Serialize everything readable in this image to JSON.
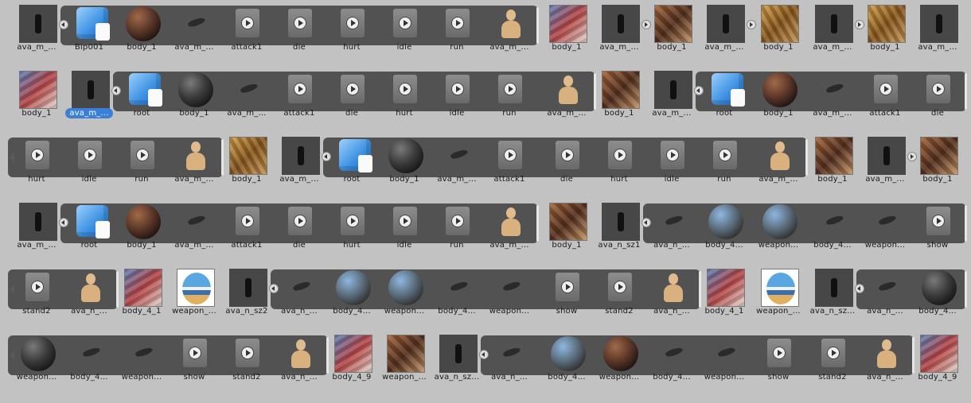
{
  "rows": [
    {
      "lead_arrow": false,
      "items": [
        {
          "label": "ava_m_...",
          "icon": "thumb-creature-icon",
          "kind": "thumb",
          "selected": false,
          "expand": "collapse"
        },
        {
          "label": "Bip001",
          "icon": "prefab-cube-icon",
          "kind": "cube"
        },
        {
          "label": "body_1",
          "icon": "material-sphere-icon",
          "kind": "sphere"
        },
        {
          "label": "ava_m_...",
          "icon": "mesh-icon",
          "kind": "mesh"
        },
        {
          "label": "attack1",
          "icon": "animation-clip-icon",
          "kind": "anim"
        },
        {
          "label": "die",
          "icon": "animation-clip-icon",
          "kind": "anim"
        },
        {
          "label": "hurt",
          "icon": "animation-clip-icon",
          "kind": "anim"
        },
        {
          "label": "idle",
          "icon": "animation-clip-icon",
          "kind": "anim"
        },
        {
          "label": "run",
          "icon": "animation-clip-icon",
          "kind": "anim"
        },
        {
          "label": "ava_m_...",
          "icon": "avatar-mannequin-icon",
          "kind": "mannequin"
        },
        {
          "label": "body_1",
          "icon": "texture-icon",
          "kind": "tile",
          "variant": "blue"
        },
        {
          "label": "ava_m_...",
          "icon": "thumb-creature-icon",
          "kind": "thumb",
          "expand": "expand"
        },
        {
          "label": "body_1",
          "icon": "texture-icon",
          "kind": "tile"
        },
        {
          "label": "ava_m_...",
          "icon": "thumb-creature-icon",
          "kind": "thumb",
          "expand": "expand"
        },
        {
          "label": "body_1",
          "icon": "texture-icon",
          "kind": "tile",
          "variant": "gold"
        },
        {
          "label": "ava_m_...",
          "icon": "thumb-creature-icon",
          "kind": "thumb",
          "expand": "expand"
        },
        {
          "label": "body_1",
          "icon": "texture-icon",
          "kind": "tile",
          "variant": "gold"
        },
        {
          "label": "ava_m_...",
          "icon": "thumb-creature-icon",
          "kind": "thumb"
        }
      ]
    },
    {
      "lead_arrow": false,
      "items": [
        {
          "label": "body_1",
          "icon": "texture-icon",
          "kind": "tile",
          "variant": "blue"
        },
        {
          "label": "ava_m_...",
          "icon": "thumb-creature-icon",
          "kind": "thumb",
          "selected": true,
          "expand": "collapse"
        },
        {
          "label": "root",
          "icon": "prefab-cube-icon",
          "kind": "cube"
        },
        {
          "label": "body_1",
          "icon": "material-sphere-icon",
          "kind": "sphere",
          "variant": "dark"
        },
        {
          "label": "ava_m_...",
          "icon": "mesh-icon",
          "kind": "mesh"
        },
        {
          "label": "attack1",
          "icon": "animation-clip-icon",
          "kind": "anim"
        },
        {
          "label": "die",
          "icon": "animation-clip-icon",
          "kind": "anim"
        },
        {
          "label": "hurt",
          "icon": "animation-clip-icon",
          "kind": "anim"
        },
        {
          "label": "idle",
          "icon": "animation-clip-icon",
          "kind": "anim"
        },
        {
          "label": "run",
          "icon": "animation-clip-icon",
          "kind": "anim"
        },
        {
          "label": "ava_m_...",
          "icon": "avatar-mannequin-icon",
          "kind": "mannequin"
        },
        {
          "label": "body_1",
          "icon": "texture-icon",
          "kind": "tile"
        },
        {
          "label": "ava_m_...",
          "icon": "thumb-creature-icon",
          "kind": "thumb",
          "expand": "collapse"
        },
        {
          "label": "root",
          "icon": "prefab-cube-icon",
          "kind": "cube"
        },
        {
          "label": "body_1",
          "icon": "material-sphere-icon",
          "kind": "sphere"
        },
        {
          "label": "ava_m_...",
          "icon": "mesh-icon",
          "kind": "mesh"
        },
        {
          "label": "attack1",
          "icon": "animation-clip-icon",
          "kind": "anim"
        },
        {
          "label": "die",
          "icon": "animation-clip-icon",
          "kind": "anim"
        }
      ]
    },
    {
      "lead_arrow": true,
      "items": [
        {
          "label": "hurt",
          "icon": "animation-clip-icon",
          "kind": "anim"
        },
        {
          "label": "idle",
          "icon": "animation-clip-icon",
          "kind": "anim"
        },
        {
          "label": "run",
          "icon": "animation-clip-icon",
          "kind": "anim"
        },
        {
          "label": "ava_m_...",
          "icon": "avatar-mannequin-icon",
          "kind": "mannequin"
        },
        {
          "label": "body_1",
          "icon": "texture-icon",
          "kind": "tile",
          "variant": "gold"
        },
        {
          "label": "ava_m_...",
          "icon": "thumb-creature-icon",
          "kind": "thumb",
          "expand": "collapse"
        },
        {
          "label": "root",
          "icon": "prefab-cube-icon",
          "kind": "cube"
        },
        {
          "label": "body_1",
          "icon": "material-sphere-icon",
          "kind": "sphere",
          "variant": "dark"
        },
        {
          "label": "ava_m_...",
          "icon": "mesh-icon",
          "kind": "mesh"
        },
        {
          "label": "attack1",
          "icon": "animation-clip-icon",
          "kind": "anim"
        },
        {
          "label": "die",
          "icon": "animation-clip-icon",
          "kind": "anim"
        },
        {
          "label": "hurt",
          "icon": "animation-clip-icon",
          "kind": "anim"
        },
        {
          "label": "idle",
          "icon": "animation-clip-icon",
          "kind": "anim"
        },
        {
          "label": "run",
          "icon": "animation-clip-icon",
          "kind": "anim"
        },
        {
          "label": "ava_m_...",
          "icon": "avatar-mannequin-icon",
          "kind": "mannequin"
        },
        {
          "label": "body_1",
          "icon": "texture-icon",
          "kind": "tile"
        },
        {
          "label": "ava_m_...",
          "icon": "thumb-creature-icon",
          "kind": "thumb",
          "expand": "expand"
        },
        {
          "label": "body_1",
          "icon": "texture-icon",
          "kind": "tile"
        }
      ]
    },
    {
      "lead_arrow": false,
      "items": [
        {
          "label": "ava_m_...",
          "icon": "thumb-creature-icon",
          "kind": "thumb",
          "expand": "collapse"
        },
        {
          "label": "root",
          "icon": "prefab-cube-icon",
          "kind": "cube"
        },
        {
          "label": "body_1",
          "icon": "material-sphere-icon",
          "kind": "sphere"
        },
        {
          "label": "ava_m_...",
          "icon": "mesh-icon",
          "kind": "mesh"
        },
        {
          "label": "attack1",
          "icon": "animation-clip-icon",
          "kind": "anim"
        },
        {
          "label": "die",
          "icon": "animation-clip-icon",
          "kind": "anim"
        },
        {
          "label": "hurt",
          "icon": "animation-clip-icon",
          "kind": "anim"
        },
        {
          "label": "idle",
          "icon": "animation-clip-icon",
          "kind": "anim"
        },
        {
          "label": "run",
          "icon": "animation-clip-icon",
          "kind": "anim"
        },
        {
          "label": "ava_m_...",
          "icon": "avatar-mannequin-icon",
          "kind": "mannequin"
        },
        {
          "label": "body_1",
          "icon": "texture-icon",
          "kind": "tile"
        },
        {
          "label": "ava_n_sz1",
          "icon": "thumb-creature-icon",
          "kind": "thumb",
          "expand": "collapse"
        },
        {
          "label": "ava_n_...",
          "icon": "mesh-icon",
          "kind": "mesh"
        },
        {
          "label": "body_4...",
          "icon": "material-sphere-icon",
          "kind": "sphere",
          "variant": "blue"
        },
        {
          "label": "weapon...",
          "icon": "material-sphere-icon",
          "kind": "sphere",
          "variant": "blue"
        },
        {
          "label": "body_4...",
          "icon": "mesh-icon",
          "kind": "mesh"
        },
        {
          "label": "weapon...",
          "icon": "mesh-icon",
          "kind": "mesh"
        },
        {
          "label": "show",
          "icon": "animation-clip-icon",
          "kind": "anim"
        }
      ]
    },
    {
      "lead_arrow": true,
      "items": [
        {
          "label": "stand2",
          "icon": "animation-clip-icon",
          "kind": "anim"
        },
        {
          "label": "ava_n_...",
          "icon": "avatar-mannequin-icon",
          "kind": "mannequin"
        },
        {
          "label": "body_4_1",
          "icon": "texture-icon",
          "kind": "tile",
          "variant": "blue"
        },
        {
          "label": "weapon_...",
          "icon": "texture-egg-icon",
          "kind": "egg"
        },
        {
          "label": "ava_n_sz2",
          "icon": "thumb-creature-icon",
          "kind": "thumb",
          "expand": "collapse"
        },
        {
          "label": "ava_n_...",
          "icon": "mesh-icon",
          "kind": "mesh"
        },
        {
          "label": "body_4...",
          "icon": "material-sphere-icon",
          "kind": "sphere",
          "variant": "blue"
        },
        {
          "label": "weapon...",
          "icon": "material-sphere-icon",
          "kind": "sphere",
          "variant": "blue"
        },
        {
          "label": "body_4...",
          "icon": "mesh-icon",
          "kind": "mesh"
        },
        {
          "label": "weapon...",
          "icon": "mesh-icon",
          "kind": "mesh"
        },
        {
          "label": "show",
          "icon": "animation-clip-icon",
          "kind": "anim"
        },
        {
          "label": "stand2",
          "icon": "animation-clip-icon",
          "kind": "anim"
        },
        {
          "label": "ava_n_...",
          "icon": "avatar-mannequin-icon",
          "kind": "mannequin"
        },
        {
          "label": "body_4_1",
          "icon": "texture-icon",
          "kind": "tile",
          "variant": "blue"
        },
        {
          "label": "weapon_...",
          "icon": "texture-egg-icon",
          "kind": "egg"
        },
        {
          "label": "ava_n_sz...",
          "icon": "thumb-creature-icon",
          "kind": "thumb",
          "expand": "collapse"
        },
        {
          "label": "ava_n_...",
          "icon": "mesh-icon",
          "kind": "mesh"
        },
        {
          "label": "body_4...",
          "icon": "material-sphere-icon",
          "kind": "sphere",
          "variant": "dark"
        }
      ]
    },
    {
      "lead_arrow": true,
      "items": [
        {
          "label": "weapon...",
          "icon": "material-sphere-icon",
          "kind": "sphere",
          "variant": "dark"
        },
        {
          "label": "body_4...",
          "icon": "mesh-icon",
          "kind": "mesh"
        },
        {
          "label": "weapon...",
          "icon": "mesh-icon",
          "kind": "mesh"
        },
        {
          "label": "show",
          "icon": "animation-clip-icon",
          "kind": "anim"
        },
        {
          "label": "stand2",
          "icon": "animation-clip-icon",
          "kind": "anim"
        },
        {
          "label": "ava_n_...",
          "icon": "avatar-mannequin-icon",
          "kind": "mannequin"
        },
        {
          "label": "body_4_9",
          "icon": "texture-icon",
          "kind": "tile",
          "variant": "blue"
        },
        {
          "label": "weapon_...",
          "icon": "texture-icon",
          "kind": "tile"
        },
        {
          "label": "ava_n_sz...",
          "icon": "thumb-creature-icon",
          "kind": "thumb",
          "expand": "collapse"
        },
        {
          "label": "ava_n_...",
          "icon": "mesh-icon",
          "kind": "mesh"
        },
        {
          "label": "body_4...",
          "icon": "material-sphere-icon",
          "kind": "sphere",
          "variant": "blue"
        },
        {
          "label": "weapon...",
          "icon": "material-sphere-icon",
          "kind": "sphere"
        },
        {
          "label": "body_4...",
          "icon": "mesh-icon",
          "kind": "mesh"
        },
        {
          "label": "weapon...",
          "icon": "mesh-icon",
          "kind": "mesh"
        },
        {
          "label": "show",
          "icon": "animation-clip-icon",
          "kind": "anim"
        },
        {
          "label": "stand2",
          "icon": "animation-clip-icon",
          "kind": "anim"
        },
        {
          "label": "ava_n_...",
          "icon": "avatar-mannequin-icon",
          "kind": "mannequin"
        },
        {
          "label": "body_4_9",
          "icon": "texture-icon",
          "kind": "tile",
          "variant": "blue"
        }
      ]
    }
  ],
  "colors": {
    "background": "#c2c2c2",
    "strip": "#525252",
    "selection": "#3c7fd8"
  }
}
